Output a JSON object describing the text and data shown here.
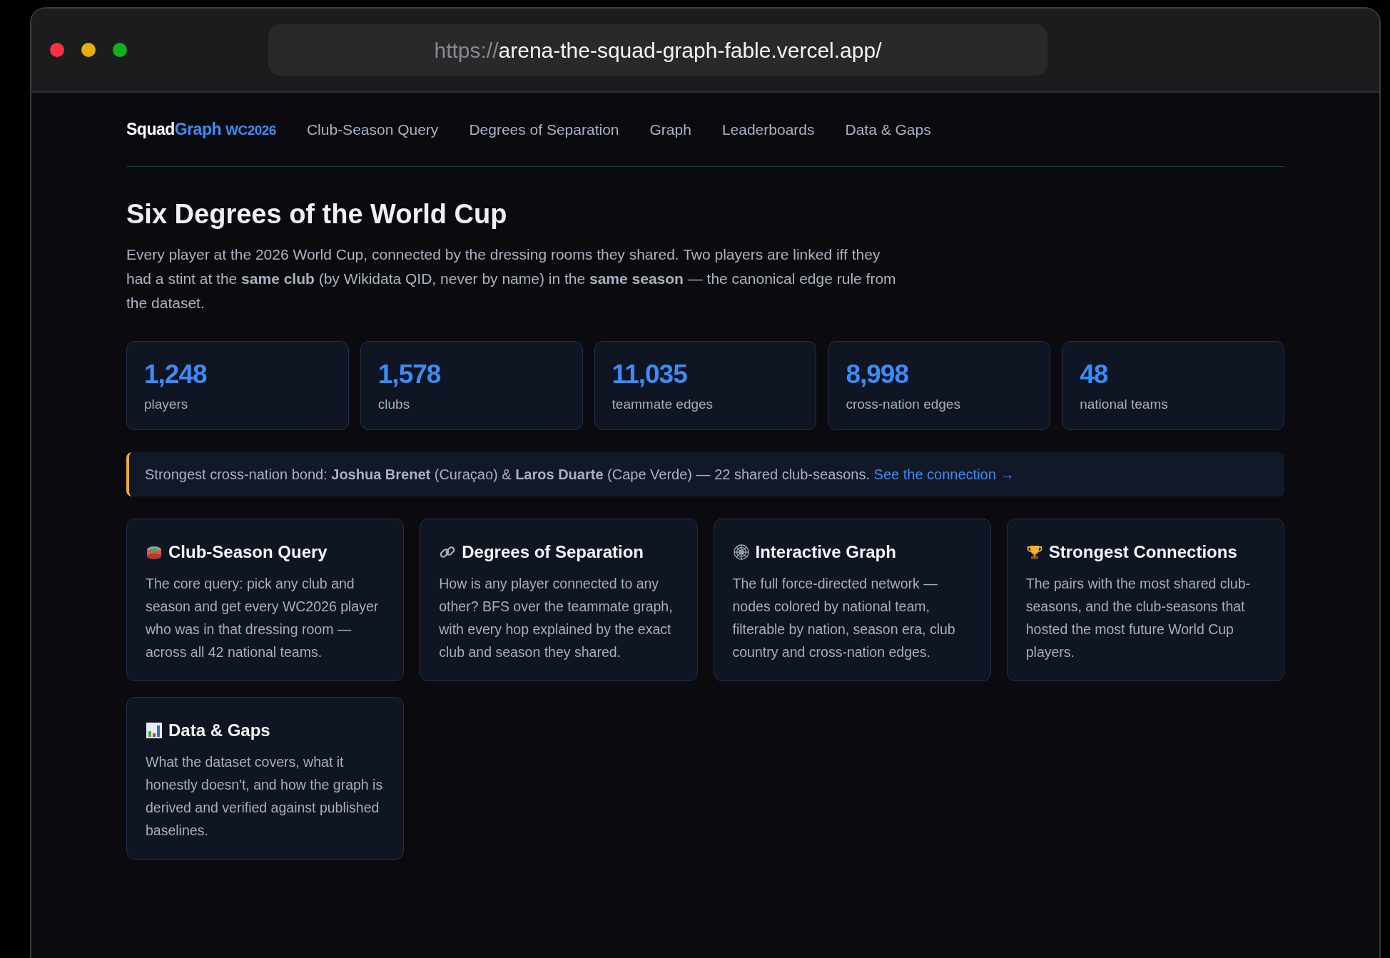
{
  "browser": {
    "url_scheme": "https://",
    "url_rest": "arena-the-squad-graph-fable.vercel.app/"
  },
  "brand": {
    "part_1": "Squad",
    "part_2": "Graph",
    "tag": "WC2026"
  },
  "nav": [
    "Club-Season Query",
    "Degrees of Separation",
    "Graph",
    "Leaderboards",
    "Data & Gaps"
  ],
  "title": "Six Degrees of the World Cup",
  "intro": "Every player at the 2026 World Cup, connected by the dressing rooms they shared. Two players are linked iff they had a stint at the **same club** (by Wikidata QID, never by name) in the **same season** — the canonical edge rule from the dataset.",
  "stats": [
    {
      "value": "1,248",
      "label": "players"
    },
    {
      "value": "1,578",
      "label": "clubs"
    },
    {
      "value": "11,035",
      "label": "teammate edges"
    },
    {
      "value": "8,998",
      "label": "cross-nation edges"
    },
    {
      "value": "48",
      "label": "national teams"
    }
  ],
  "banner": {
    "text": "Strongest cross-nation bond: **Joshua Brenet** (Curaçao) & **Laros Duarte** (Cape Verde) — 22 shared club-seasons.",
    "link": "See the connection →"
  },
  "features": [
    {
      "kind": "stadium",
      "title": "Club-Season Query",
      "text": "The core query: pick any club and season and get every WC2026 player who was in that dressing room — across all 42 national teams."
    },
    {
      "kind": "link",
      "title": "Degrees of Separation",
      "text": "How is any player connected to any other? BFS over the teammate graph, with every hop explained by the exact club and season they shared."
    },
    {
      "kind": "web",
      "title": "Interactive Graph",
      "text": "The full force-directed network — nodes colored by national team, filterable by nation, season era, club country and cross-nation edges."
    },
    {
      "kind": "trophy",
      "title": "Strongest Connections",
      "text": "The pairs with the most shared club-seasons, and the club-seasons that hosted the most future World Cup players."
    },
    {
      "kind": "chart",
      "title": "Data & Gaps",
      "text": "What the dataset covers, what it honestly doesn't, and how the graph is derived and verified against published baselines."
    }
  ]
}
